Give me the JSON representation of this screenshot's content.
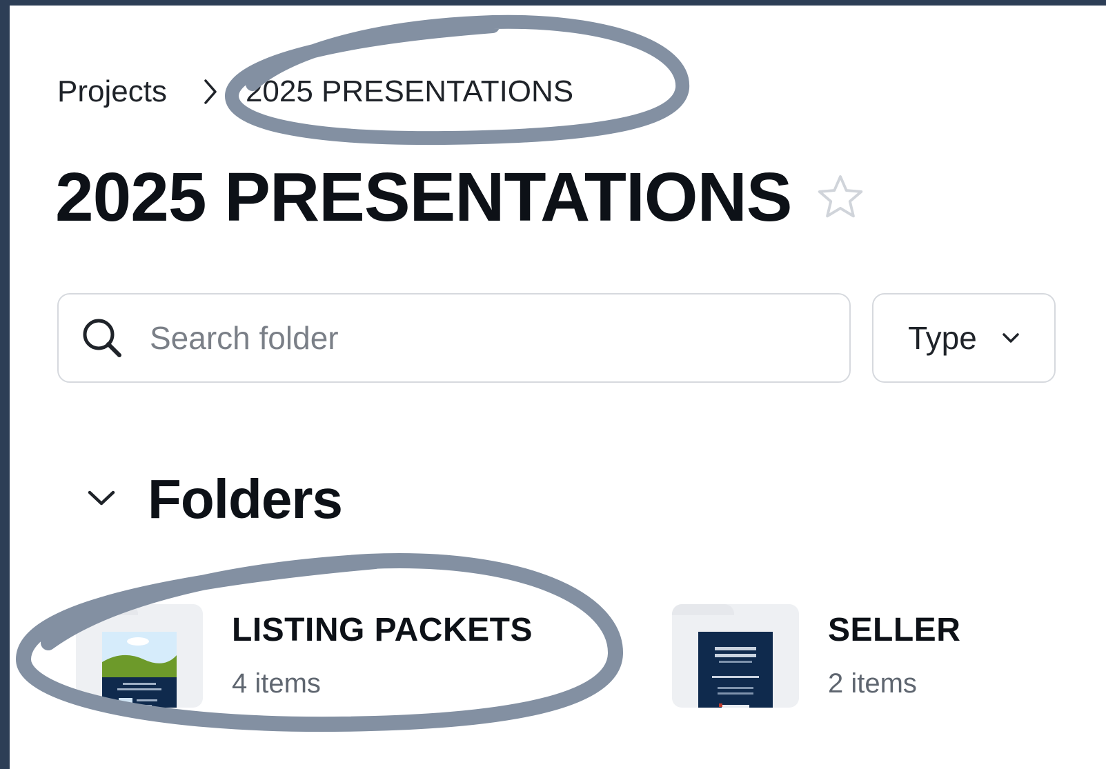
{
  "breadcrumb": {
    "root": "Projects",
    "current": "2025 PRESENTATIONS"
  },
  "page": {
    "title": "2025 PRESENTATIONS"
  },
  "search": {
    "placeholder": "Search folder",
    "value": ""
  },
  "filter": {
    "type_label": "Type"
  },
  "section": {
    "title": "Folders"
  },
  "folders": [
    {
      "name": "LISTING PACKETS",
      "count": "4 items"
    },
    {
      "name": "SELLER",
      "count": "2 items"
    }
  ],
  "colors": {
    "frame": "#2d3e56",
    "annotation": "#8390a2",
    "doc_navy": "#0f2a4d",
    "grass": "#6d9a2a",
    "sky": "#d6ecfb"
  },
  "icons": {
    "breadcrumb_separator": "chevron-right-icon",
    "favorite": "star-icon",
    "search": "search-icon",
    "type_dropdown": "chevron-down-icon",
    "section_toggle": "chevron-down-icon"
  }
}
